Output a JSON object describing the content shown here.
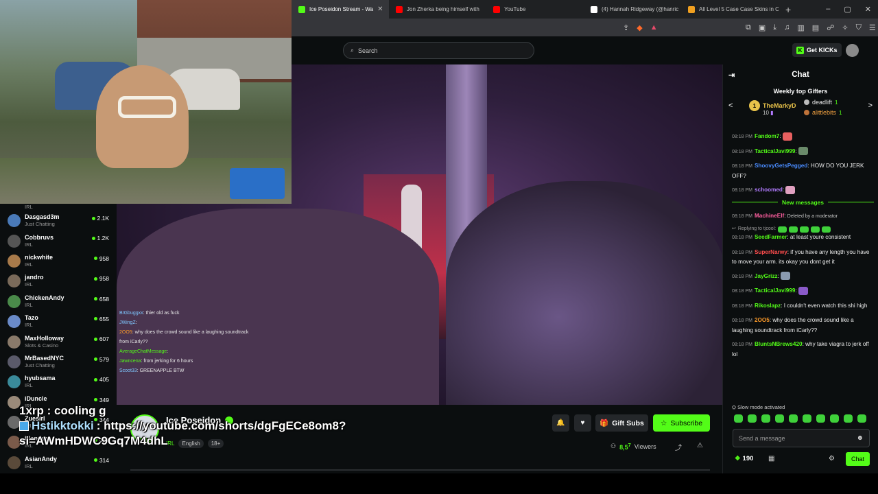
{
  "browser": {
    "tabs": [
      {
        "label": "Ice Poseidon Stream - Wa",
        "color": "#53fc18",
        "active": true
      },
      {
        "label": "Jon Zherka being himself with",
        "color": "#ff0000",
        "active": false
      },
      {
        "label": "YouTube",
        "color": "#ff0000",
        "active": false
      },
      {
        "label": "(4) Hannah Ridgeway (@hanric",
        "color": "#ffffff",
        "active": false
      },
      {
        "label": "All Level 5 Case Case Skins in C",
        "color": "#f0a020",
        "active": false
      }
    ],
    "new_tab": "+",
    "window_controls": [
      "–",
      "▢",
      "✕"
    ]
  },
  "header": {
    "search_placeholder": "Search",
    "get_kicks": "Get KICKs"
  },
  "sidebar": {
    "top_category": "IRL",
    "items": [
      {
        "name": "Dasgasd3m",
        "category": "Just Chatting",
        "viewers": "2.1K"
      },
      {
        "name": "Cobbruvs",
        "category": "IRL",
        "viewers": "1.2K"
      },
      {
        "name": "nickwhite",
        "category": "IRL",
        "viewers": "958"
      },
      {
        "name": "jandro",
        "category": "IRL",
        "viewers": "958"
      },
      {
        "name": "ChickenAndy",
        "category": "IRL",
        "viewers": "658"
      },
      {
        "name": "Tazo",
        "category": "IRL",
        "viewers": "655"
      },
      {
        "name": "MaxHolloway",
        "category": "Slots & Casino",
        "viewers": "607"
      },
      {
        "name": "MrBasedNYC",
        "category": "Just Chatting",
        "viewers": "579"
      },
      {
        "name": "hyubsama",
        "category": "IRL",
        "viewers": "405"
      },
      {
        "name": "iDuncle",
        "category": "IRL",
        "viewers": "349"
      },
      {
        "name": "Zuesirl",
        "category": "IRL",
        "viewers": "344"
      },
      {
        "name": "Irlandas",
        "category": "IRL",
        "viewers": "316"
      },
      {
        "name": "AsianAndy",
        "category": "IRL",
        "viewers": "314"
      }
    ]
  },
  "video_chat_overlay": [
    {
      "user": "BIGbuggxx",
      "text": "thier old as fuck"
    },
    {
      "user": "JWingZ",
      "text": ""
    },
    {
      "user": "2OO5",
      "text": "why does the crowd sound like a laughing soundtrack from iCarly??"
    },
    {
      "user": "AverageChatMessage",
      "text": ""
    },
    {
      "user": "Jawncena",
      "text": "from jerking for 6 hours"
    },
    {
      "user": "Scoot33",
      "text": "GREENAPPLE BTW"
    }
  ],
  "channel": {
    "name": "Ice Poseidon",
    "live_badge": "LIVE",
    "tags": [
      "IRL",
      "English",
      "18+"
    ],
    "gift_subs": "Gift Subs",
    "subscribe": "Subscribe",
    "viewers_count": "8,5",
    "viewers_count_tail": "7",
    "viewers_label": "Viewers"
  },
  "caption": {
    "line1": "1xrp : cooling g",
    "line2_user": "Hstikktokki",
    "line2_text": ": https://youtube.com/shorts/dgFgECe8om8?",
    "line3": "si=AWmHDWC9Gq7M4dhL"
  },
  "chat": {
    "title": "Chat",
    "weekly_title": "Weekly top Gifters",
    "gifters": [
      {
        "name": "TheMarkyD",
        "count": "10",
        "rank": "1"
      },
      {
        "name": "deadlift",
        "count": "1"
      },
      {
        "name": "alittlebits",
        "count": "1"
      }
    ],
    "messages": [
      {
        "time": "08:18 PM",
        "user": "Fandom7",
        "color": "#53fc18",
        "text": ":",
        "emote": "#e86060"
      },
      {
        "time": "08:18 PM",
        "user": "TacticalJavi999",
        "color": "#53fc18",
        "text": ":",
        "emote": "#6a8a6a"
      },
      {
        "time": "08:18 PM",
        "user": "ShoovyGetsPegged",
        "color": "#4a8cff",
        "text": ": HOW DO YOU JERK OFF?"
      },
      {
        "time": "08:18 PM",
        "user": "schoomed",
        "color": "#b27bff",
        "text": ":",
        "emote": "#e0a0c0"
      }
    ],
    "new_messages_label": "New messages",
    "messages_after": [
      {
        "time": "08:18 PM",
        "user": "MachineElf",
        "color": "#ff5fa0",
        "text": ": ",
        "deleted": "Deleted by a moderator"
      },
      {
        "time": "08:18 PM",
        "user": "SeedFarmer",
        "color": "#53fc18",
        "text": ": at least youre consistent",
        "reply": "Replying to tjcool:"
      },
      {
        "time": "08:18 PM",
        "user": "SuperNarwy",
        "color": "#ff4d4d",
        "text": ": if you have any length you have to move your arm. its okay you dont get it"
      },
      {
        "time": "08:18 PM",
        "user": "JayGrizz",
        "color": "#53fc18",
        "text": ":",
        "emote": "#8a9ab0"
      },
      {
        "time": "08:18 PM",
        "user": "TacticalJavi999",
        "color": "#53fc18",
        "text": ":",
        "emote": "#8a5ac8"
      },
      {
        "time": "08:18 PM",
        "user": "Rikoslapz",
        "color": "#53fc18",
        "text": ": I couldn't even watch this shi high"
      },
      {
        "time": "08:18 PM",
        "user": "2OO5",
        "color": "#ff9c2a",
        "text": ": why does the crowd sound like a laughing soundtrack from iCarly??"
      },
      {
        "time": "08:18 PM",
        "user": "BluntsNBrews420",
        "color": "#53fc18",
        "text": ": why take viagra to jerk off lol"
      }
    ],
    "slow_mode": "Slow mode activated",
    "send_placeholder": "Send a message",
    "points": "190",
    "chat_button": "Chat"
  }
}
